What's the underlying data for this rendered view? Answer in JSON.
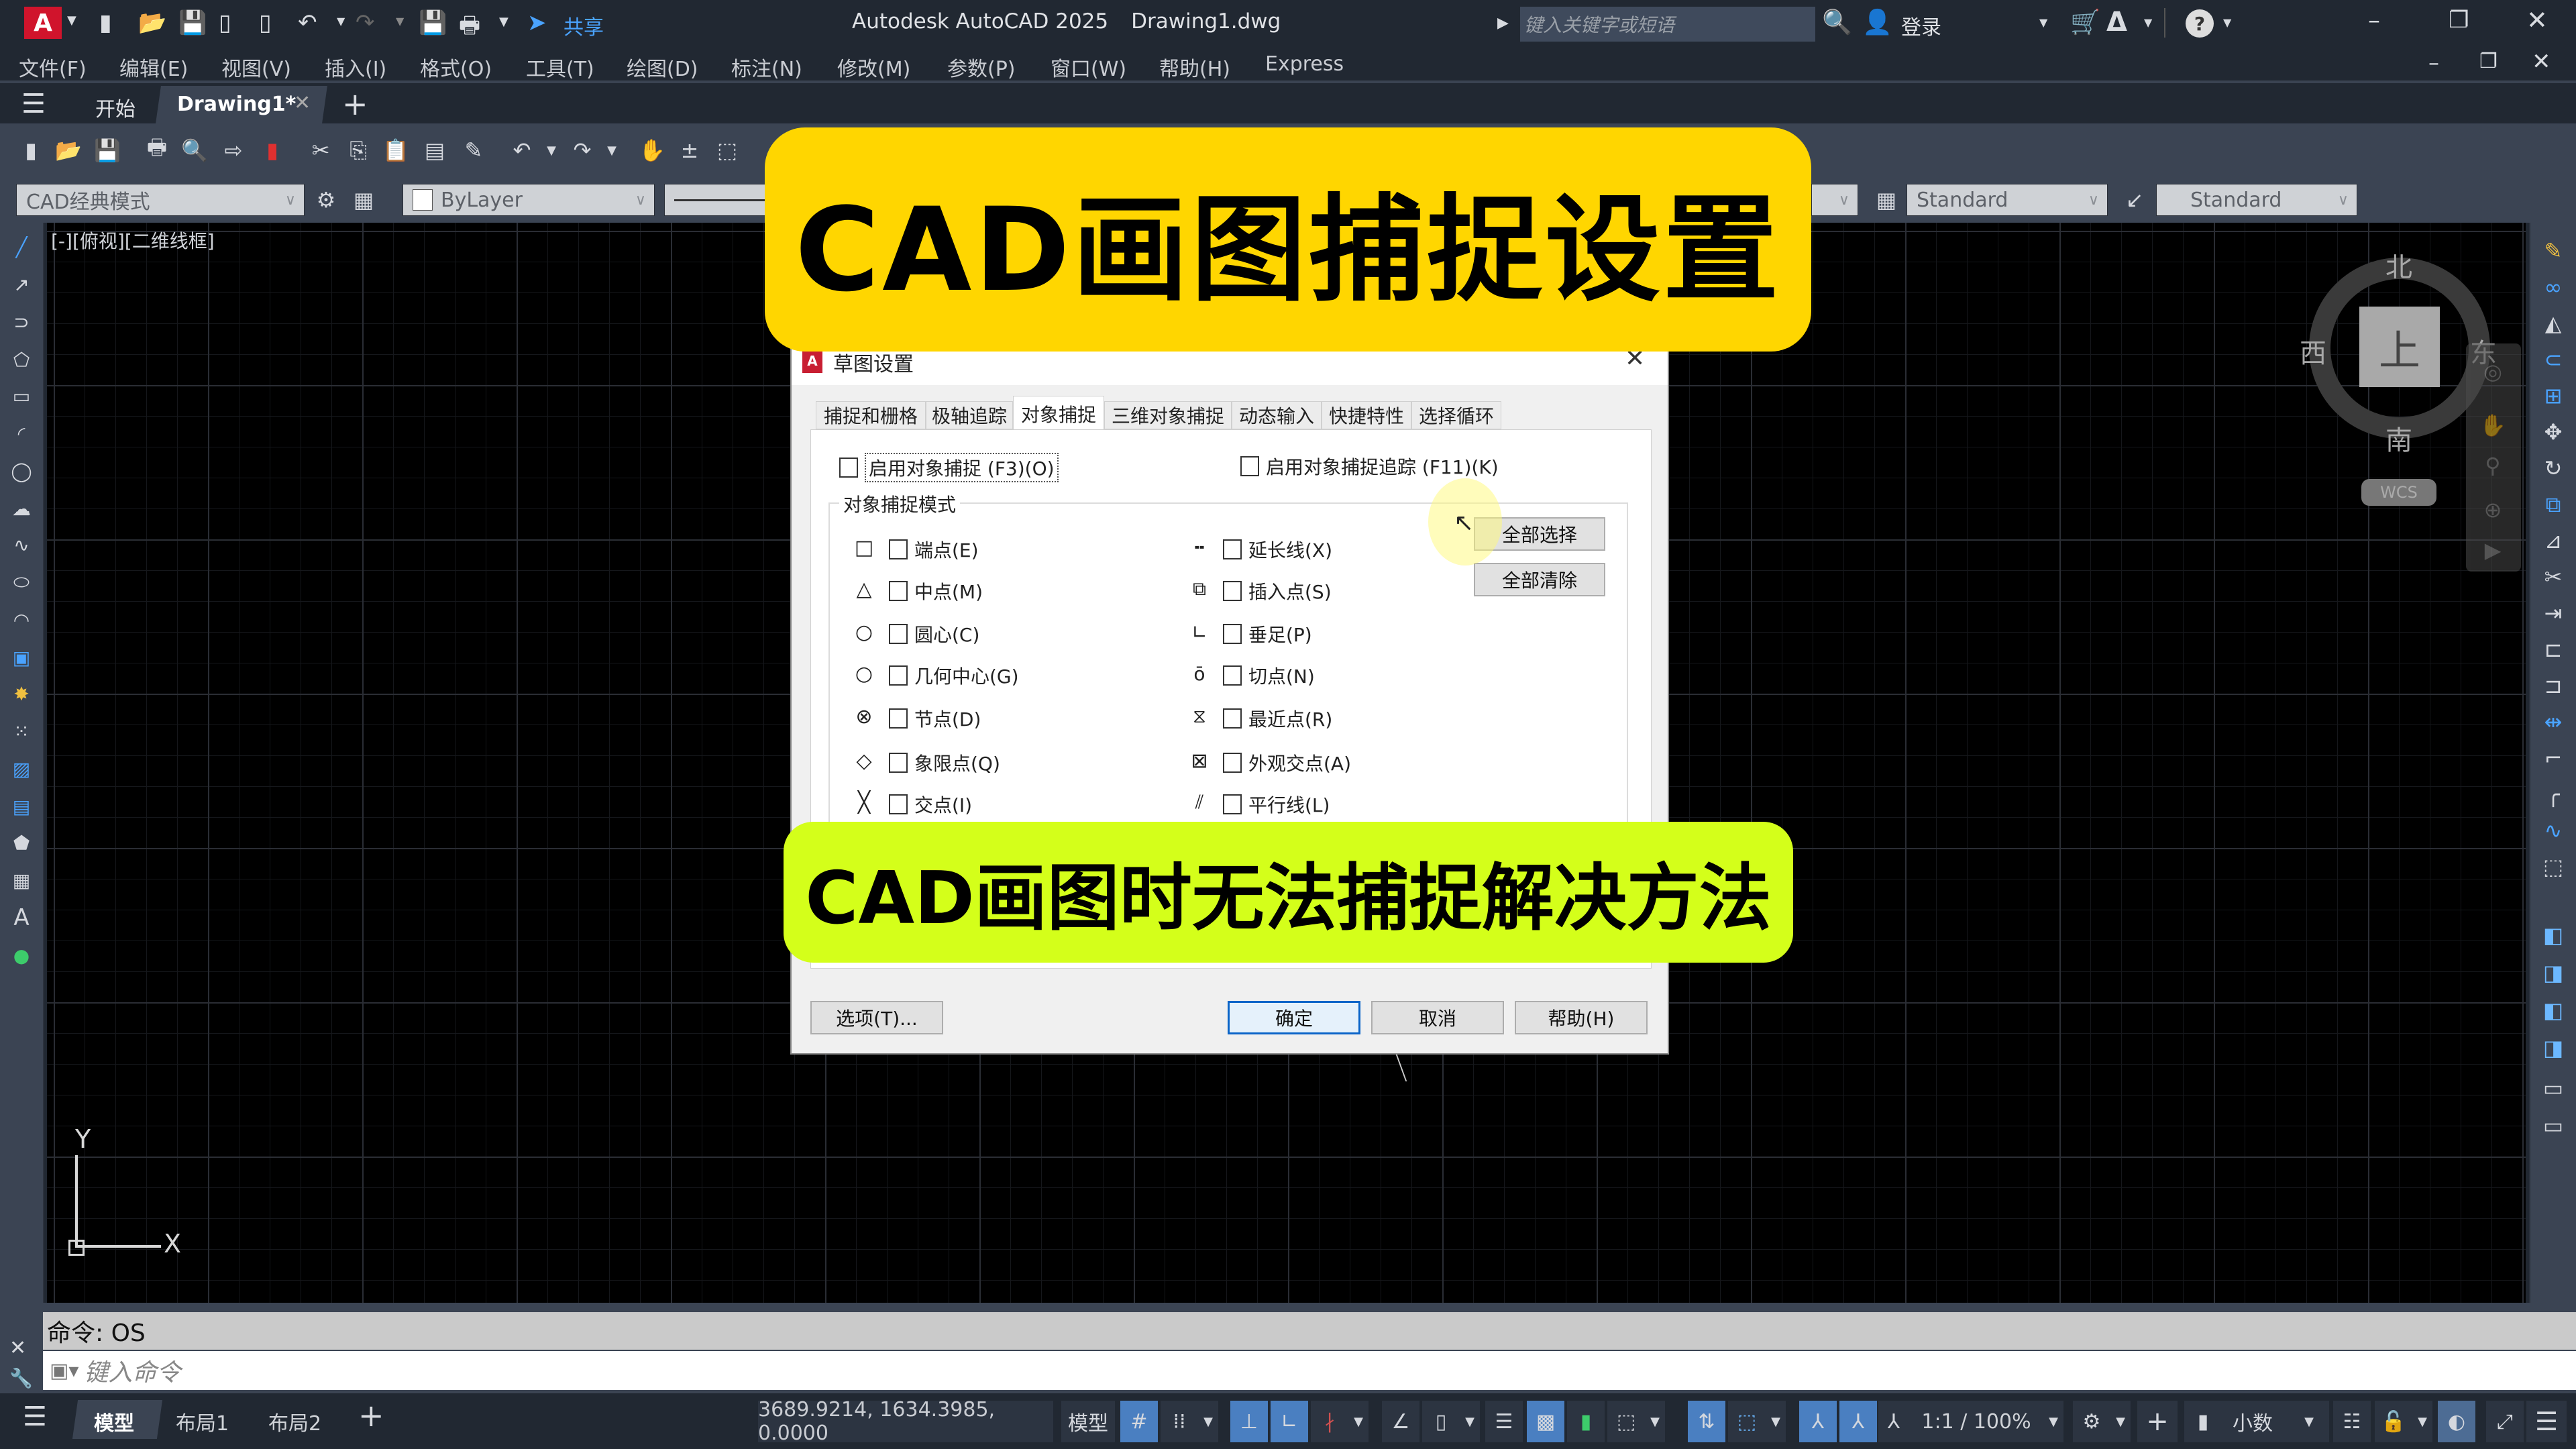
{
  "titlebar": {
    "app_title": "Autodesk AutoCAD 2025",
    "file_name": "Drawing1.dwg",
    "share_label": "共享",
    "search_placeholder": "键入关键字或短语",
    "login_label": "登录"
  },
  "menubar": {
    "items": [
      "文件(F)",
      "编辑(E)",
      "视图(V)",
      "插入(I)",
      "格式(O)",
      "工具(T)",
      "绘图(D)",
      "标注(N)",
      "修改(M)",
      "参数(P)",
      "窗口(W)",
      "帮助(H)",
      "Express"
    ]
  },
  "doc_tabs": {
    "start": "开始",
    "active": "Drawing1*"
  },
  "toolbar2": {
    "workspace": "CAD经典模式",
    "layer_color": "ByLayer",
    "table_style": "Standard",
    "multileader_style": "Standard"
  },
  "viewport": {
    "label": "[-][俯视][二维线框]",
    "ucs_x": "X",
    "ucs_y": "Y"
  },
  "viewcube": {
    "north": "北",
    "south": "南",
    "east": "东",
    "west": "西",
    "face": "上",
    "wcs": "WCS"
  },
  "dialog": {
    "title": "草图设置",
    "tabs": [
      "捕捉和栅格",
      "极轴追踪",
      "对象捕捉",
      "三维对象捕捉",
      "动态输入",
      "快捷特性",
      "选择循环"
    ],
    "active_tab": "对象捕捉",
    "enable_osnap": {
      "label": "启用对象捕捉 (F3)(O)",
      "checked": false
    },
    "enable_tracking": {
      "label": "启用对象捕捉追踪 (F11)(K)",
      "checked": false
    },
    "group_label": "对象捕捉模式",
    "left_modes": [
      {
        "label": "端点(E)",
        "symbol": "square",
        "checked": false
      },
      {
        "label": "中点(M)",
        "symbol": "triangle",
        "checked": false
      },
      {
        "label": "圆心(C)",
        "symbol": "circle",
        "checked": false
      },
      {
        "label": "几何中心(G)",
        "symbol": "circle",
        "checked": false
      },
      {
        "label": "节点(D)",
        "symbol": "circle-x",
        "checked": false
      },
      {
        "label": "象限点(Q)",
        "symbol": "diamond",
        "checked": false
      },
      {
        "label": "交点(I)",
        "symbol": "x",
        "checked": false
      }
    ],
    "right_modes": [
      {
        "label": "延长线(X)",
        "symbol": "dashes",
        "checked": false
      },
      {
        "label": "插入点(S)",
        "symbol": "insert",
        "checked": false
      },
      {
        "label": "垂足(P)",
        "symbol": "perpendicular",
        "checked": false
      },
      {
        "label": "切点(N)",
        "symbol": "tangent",
        "checked": false
      },
      {
        "label": "最近点(R)",
        "symbol": "hourglass",
        "checked": false
      },
      {
        "label": "外观交点(A)",
        "symbol": "box-x",
        "checked": false
      },
      {
        "label": "平行线(L)",
        "symbol": "parallel",
        "checked": false
      }
    ],
    "select_all": "全部选择",
    "clear_all": "全部清除",
    "options_button": "选项(T)...",
    "ok_button": "确定",
    "cancel_button": "取消",
    "help_button": "帮助(H)"
  },
  "overlay": {
    "banner_top": "CAD画图捕捉设置",
    "banner_bottom": "CAD画图时无法捕捉解决方法",
    "colors": {
      "top": "#ffd600",
      "bottom": "#d4ff1a"
    }
  },
  "command": {
    "history": "命令: OS",
    "placeholder": "键入命令"
  },
  "layout_tabs": {
    "items": [
      "模型",
      "布局1",
      "布局2"
    ],
    "active": "模型"
  },
  "statusbar": {
    "coordinates": "3689.9214, 1634.3985, 0.0000",
    "space": "模型",
    "annotation_scale": "1:1 / 100%",
    "units": "小数"
  }
}
